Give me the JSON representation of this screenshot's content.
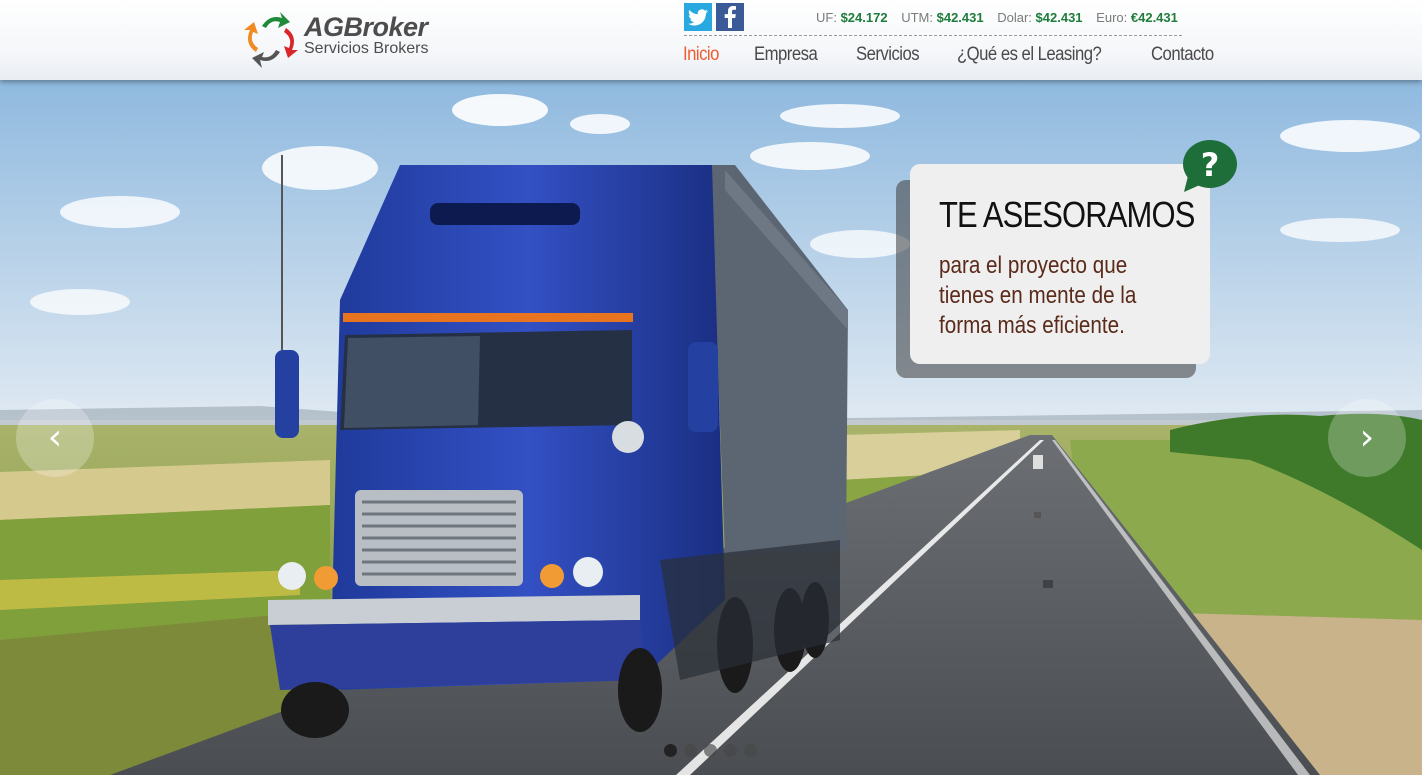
{
  "header": {
    "logo": {
      "title": "AGBroker",
      "subtitle": "Servicios Brokers"
    },
    "social": [
      {
        "name": "twitter",
        "icon": "twitter-icon",
        "color": "#2aa9e0"
      },
      {
        "name": "facebook",
        "icon": "facebook-icon",
        "color": "#3b5a98"
      }
    ],
    "indicators": [
      {
        "label": "UF:",
        "value": "$24.172"
      },
      {
        "label": "UTM:",
        "value": "$42.431"
      },
      {
        "label": "Dolar:",
        "value": "$42.431"
      },
      {
        "label": "Euro:",
        "value": "€42.431"
      }
    ],
    "nav": [
      {
        "label": "Inicio",
        "active": true
      },
      {
        "label": "Empresa",
        "active": false
      },
      {
        "label": "Servicios",
        "active": false
      },
      {
        "label": "¿Qué es el Leasing?",
        "active": false
      },
      {
        "label": "Contacto",
        "active": false
      }
    ]
  },
  "slider": {
    "callout": {
      "title": "TE ASESORAMOS",
      "text": "para el proyecto que tienes en mente de la forma más eficiente."
    },
    "prev_icon": "chevron-left-icon",
    "next_icon": "chevron-right-icon",
    "prev_glyph": "‹",
    "next_glyph": "›",
    "slide_count": 5,
    "active_slide": 1
  },
  "colors": {
    "accent": "#ef5a30",
    "indicator_value": "#1e7d3a",
    "callout_badge": "#1e6e3a"
  }
}
